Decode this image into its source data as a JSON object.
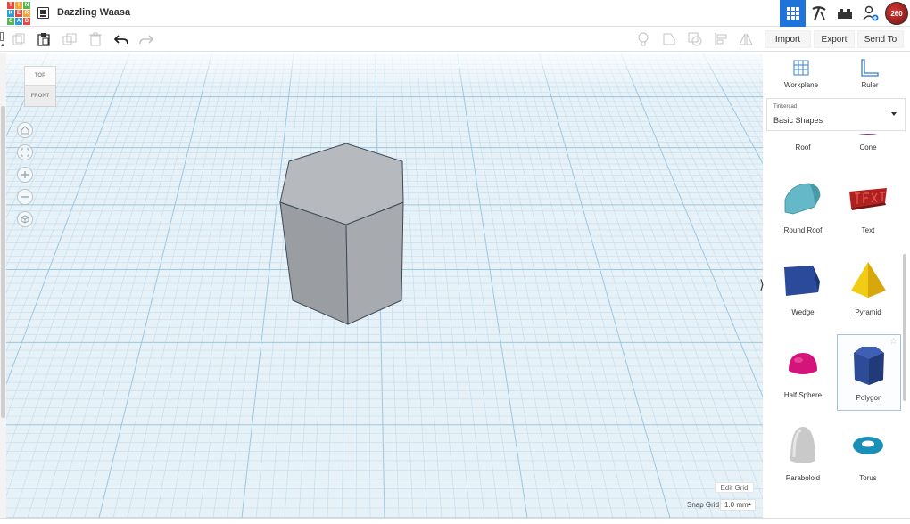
{
  "header": {
    "logo_letters": [
      "T",
      "I",
      "N",
      "K",
      "E",
      "R",
      "C",
      "A",
      "D"
    ],
    "logo_colors": [
      "#e8493f",
      "#f2a33a",
      "#5ab556",
      "#2a9fd8",
      "#e8493f",
      "#f2a33a",
      "#5ab556",
      "#2a9fd8",
      "#e8493f"
    ],
    "title": "Dazzling Waasa",
    "avatar_text": "260"
  },
  "toolbar": {
    "import_label": "Import",
    "export_label": "Export",
    "send_to_label": "Send To"
  },
  "viewcube": {
    "top": "TOP",
    "front": "FRONT"
  },
  "canvas": {
    "edit_grid_label": "Edit Grid",
    "snap_grid_label": "Snap Grid",
    "snap_value": "1.0 mm"
  },
  "panel": {
    "workplane_label": "Workplane",
    "ruler_label": "Ruler",
    "library_small": "Tinkercad",
    "library_name": "Basic Shapes",
    "shapes": [
      {
        "name": "Roof"
      },
      {
        "name": "Cone"
      },
      {
        "name": "Round Roof"
      },
      {
        "name": "Text"
      },
      {
        "name": "Wedge"
      },
      {
        "name": "Pyramid"
      },
      {
        "name": "Half Sphere"
      },
      {
        "name": "Polygon"
      },
      {
        "name": "Paraboloid"
      },
      {
        "name": "Torus"
      }
    ]
  },
  "colors": {
    "accent": "#1f73d9",
    "grid_bg": "#e6f1f8",
    "shape_gray": "#a9adb2"
  }
}
